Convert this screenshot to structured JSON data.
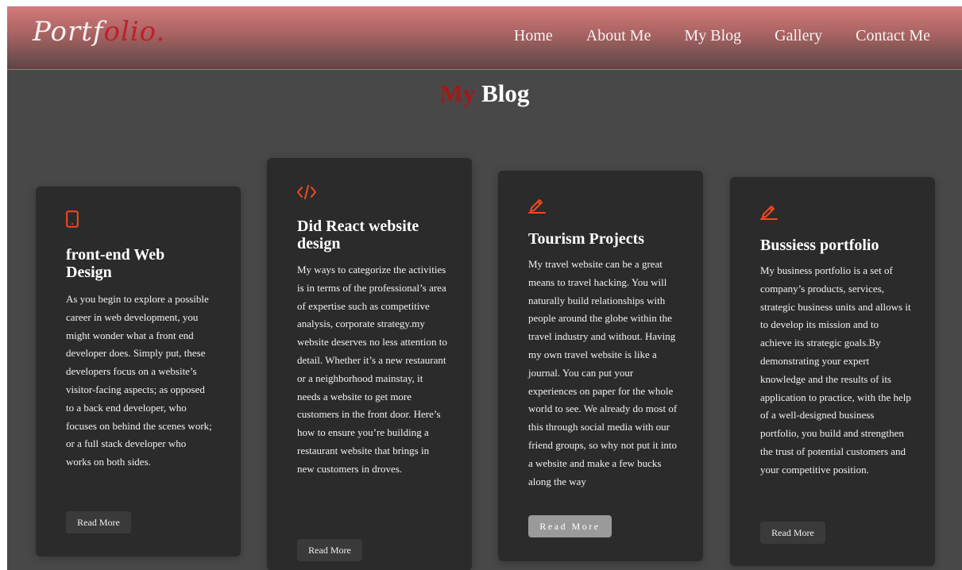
{
  "logo": {
    "part1": "Portf",
    "part2": "olio."
  },
  "nav": {
    "items": [
      {
        "label": "Home"
      },
      {
        "label": "About Me"
      },
      {
        "label": "My Blog"
      },
      {
        "label": "Gallery"
      },
      {
        "label": "Contact Me"
      }
    ]
  },
  "section_title": {
    "accent": "My",
    "rest": "Blog"
  },
  "cards": [
    {
      "icon": "mobile-icon",
      "title": "front-end Web Design",
      "text": "As you begin to explore a possible career in web development, you might wonder what a front end developer does. Simply put, these developers focus on a website’s visitor-facing aspects; as opposed to a back end developer, who focuses on behind the scenes work; or a full stack developer who works on both sides.",
      "button": "Read More"
    },
    {
      "icon": "code-icon",
      "title": "Did React website design",
      "text": "My ways to categorize the activities is in terms of the professional’s area of expertise such as competitive analysis, corporate strategy.my website deserves no less attention to detail. Whether it’s a new restaurant or a neighborhood mainstay, it needs a website to get more customers in the front door. Here’s how to ensure you’re building a restaurant website that brings in new customers in droves.",
      "button": "Read More"
    },
    {
      "icon": "pencil-icon",
      "title": "Tourism Projects",
      "text": "My travel website can be a great means to travel hacking. You will naturally build relationships with people around the globe within the travel industry and without. Having my own travel website is like a journal. You can put your experiences on paper for the whole world to see. We already do most of this through social media with our friend groups, so why not put it into a website and make a few bucks along the way",
      "button": "Read More"
    },
    {
      "icon": "pencil-icon",
      "title": "Bussiess portfolio",
      "text": "My business portfolio is a set of company’s products, services, strategic business units and allows it to develop its mission and to achieve its strategic goals.By demonstrating your expert knowledge and the results of its application to practice, with the help of a well-designed business portfolio, you build and strengthen the trust of potential customers and your competitive position.",
      "button": "Read More"
    }
  ],
  "colors": {
    "accent": "#f24a1d",
    "title_red": "#a51818",
    "card_bg": "#2b2b2b",
    "page_bg": "#484848"
  }
}
